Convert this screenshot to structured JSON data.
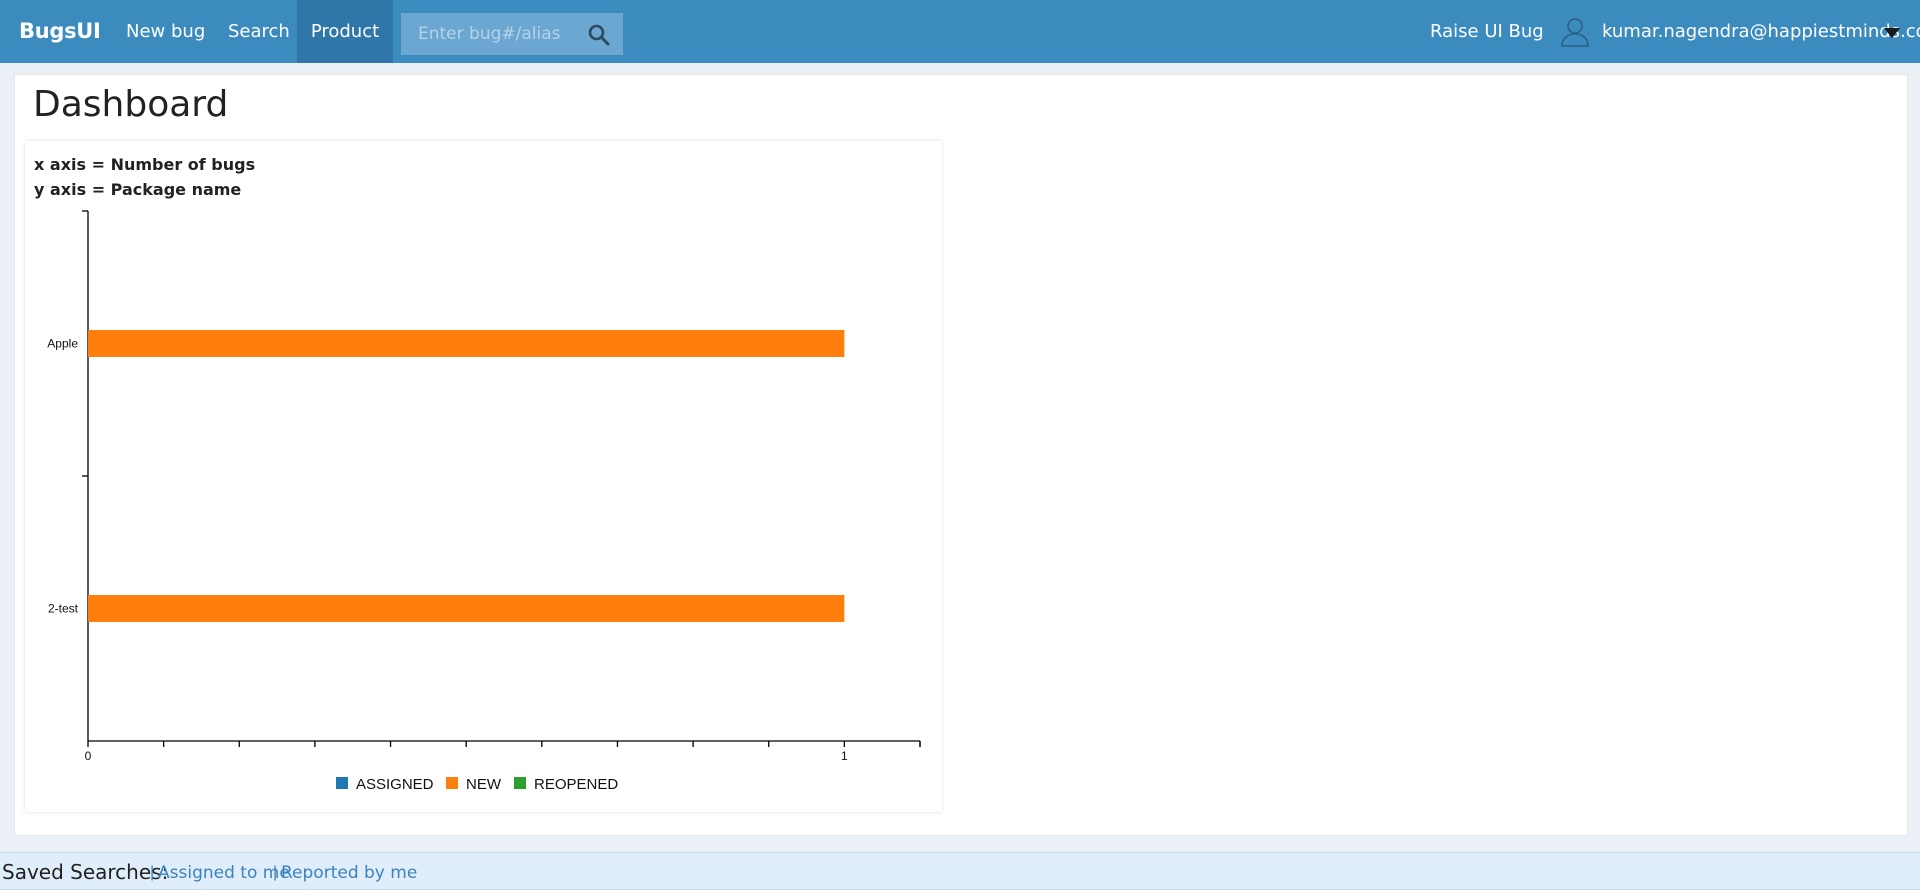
{
  "app": {
    "brand": "BugsUI",
    "nav": {
      "new_bug": "New bug",
      "search": "Search",
      "product": "Product"
    },
    "search": {
      "placeholder": "Enter bug#/alias"
    },
    "raise_ui_bug": "Raise UI Bug",
    "user_email": "kumar.nagendra@happiestminds.com",
    "icons": [
      "search-icon",
      "user-icon",
      "caret-down-icon"
    ],
    "colors": {
      "header": "#3b8bbf",
      "active_nav": "#2f77a8",
      "link": "#3b82bf"
    }
  },
  "dashboard": {
    "title": "Dashboard",
    "x_axis_note": "x axis = Number of bugs",
    "y_axis_note": "y axis = Package name"
  },
  "chart_data": {
    "type": "bar",
    "orientation": "horizontal",
    "stacked": true,
    "categories": [
      "Apple",
      "2-test"
    ],
    "series": [
      {
        "name": "ASSIGNED",
        "color": "#1f77b4",
        "values": [
          0,
          0
        ]
      },
      {
        "name": "NEW",
        "color": "#ff7f0e",
        "values": [
          1,
          1
        ]
      },
      {
        "name": "REOPENED",
        "color": "#2ca02c",
        "values": [
          0,
          0
        ]
      }
    ],
    "x_tick_labels": [
      "0",
      "1"
    ],
    "xlim": [
      0,
      1.1
    ],
    "legend_position": "bottom",
    "grid": false
  },
  "saved_searches": {
    "label": "Saved Searches:",
    "separator": "|",
    "links": [
      "Assigned to me",
      "Reported by me"
    ]
  }
}
